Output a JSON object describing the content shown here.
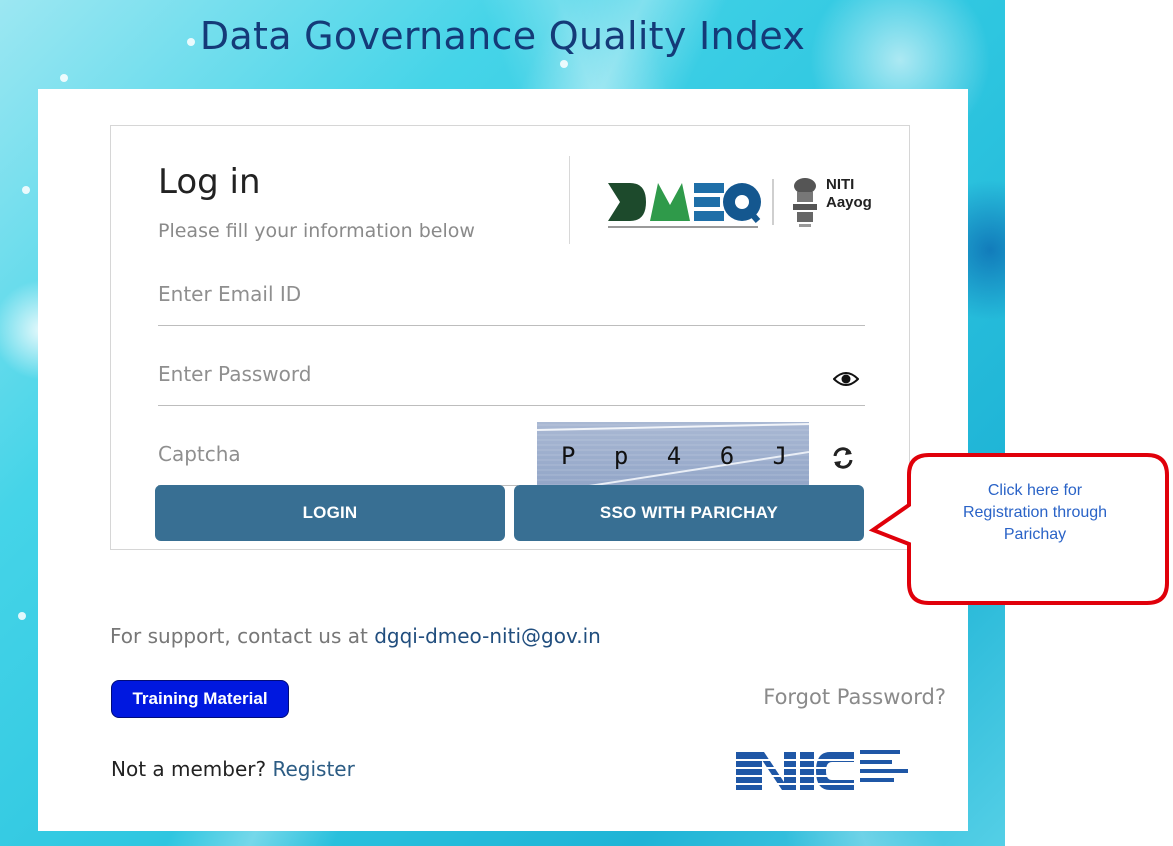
{
  "page": {
    "title": "Data Governance Quality Index"
  },
  "login": {
    "heading": "Log in",
    "subtitle": "Please fill your information below",
    "logos": {
      "dmeo": "DMEO",
      "niti_line1": "NITI",
      "niti_line2": "Aayog"
    },
    "email_placeholder": "Enter Email ID",
    "password_placeholder": "Enter Password",
    "captcha_placeholder": "Captcha",
    "captcha_text": "P p 4 6 J",
    "login_label": "LOGIN",
    "sso_label": "SSO WITH PARICHAY"
  },
  "footer": {
    "support_prefix": "For support, contact us at ",
    "support_email": "dgqi-dmeo-niti@gov.in",
    "training_label": "Training Material",
    "forgot_label": "Forgot Password?",
    "not_member": "Not a member? ",
    "register_label": "Register",
    "nic_logo": "NIC"
  },
  "callout": {
    "line1": "Click here for",
    "line2": "Registration through",
    "line3": "Parichay"
  },
  "colors": {
    "title": "#143a78",
    "button": "#386f93",
    "training_button": "#0018e0",
    "callout_border": "#e0000a",
    "callout_text": "#2a63c7"
  }
}
